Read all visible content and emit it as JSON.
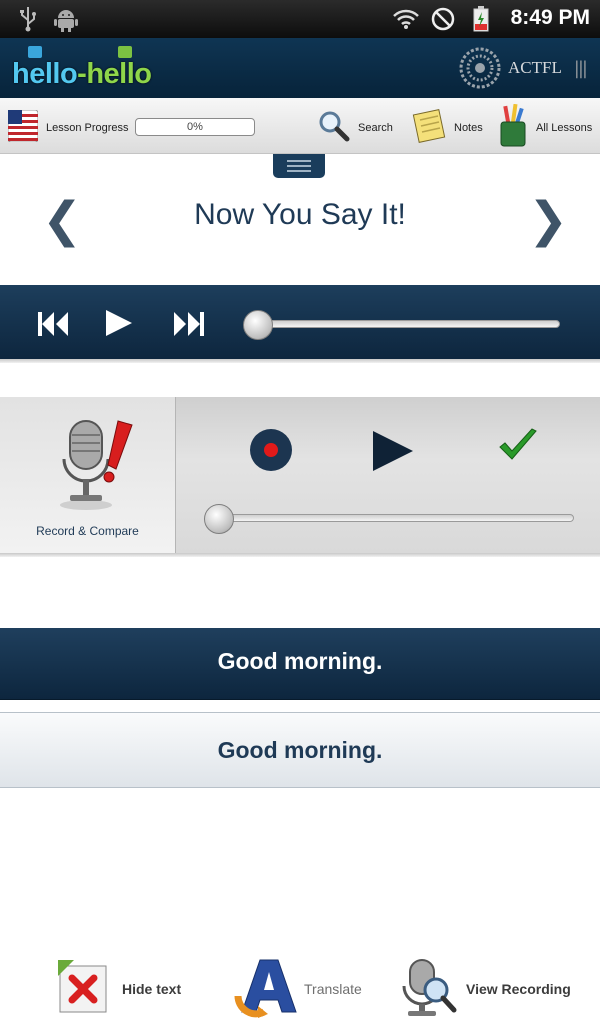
{
  "status_bar": {
    "time": "8:49 PM",
    "icons": [
      "usb-icon",
      "android-icon",
      "wifi-icon",
      "no-sign-icon",
      "battery-charging-icon"
    ]
  },
  "header": {
    "logo_part1": "hello",
    "logo_dash": "-",
    "logo_part2": "hello",
    "partner_text": "ACTFL",
    "partner_bars": "|||"
  },
  "toolbar": {
    "flag_icon": "us-flag-icon",
    "lesson_progress_label": "Lesson Progress",
    "lesson_progress_value": "0%",
    "lesson_progress_fraction": 0,
    "search_label": "Search",
    "notes_label": "Notes",
    "all_lessons_label": "All Lessons"
  },
  "title_row": {
    "prev_arrow": "❮",
    "title": "Now You Say It!",
    "next_arrow": "❯"
  },
  "player": {
    "rewind_icon": "rewind-icon",
    "play_icon": "play-icon",
    "forward_icon": "fast-forward-icon",
    "position_fraction": 0
  },
  "record": {
    "label": "Record & Compare",
    "record_icon": "record-icon",
    "play_icon": "play-icon",
    "done_icon": "checkmark-icon",
    "position_fraction": 0
  },
  "phrases": {
    "native": "Good morning.",
    "translation": "Good morning."
  },
  "bottom_actions": {
    "hide_text_label": "Hide text",
    "translate_label": "Translate",
    "view_recording_label": "View Recording",
    "colors": {
      "enabled": "#3c3c3c",
      "disabled": "#6f6f6f"
    }
  }
}
